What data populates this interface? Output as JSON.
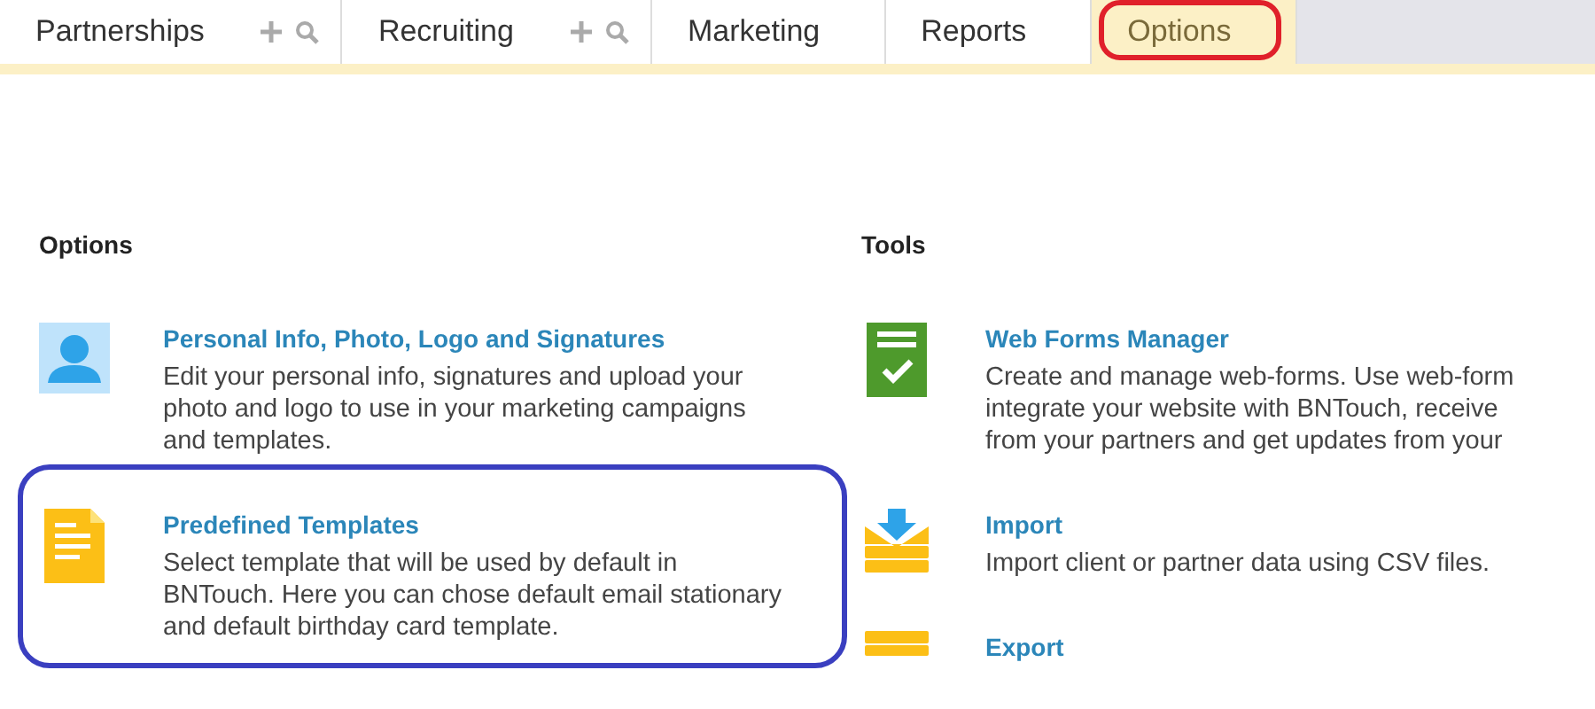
{
  "tabs": [
    {
      "label": "Partnerships",
      "selected": false,
      "actions": true,
      "circled": false
    },
    {
      "label": "Recruiting",
      "selected": false,
      "actions": true,
      "circled": false
    },
    {
      "label": "Marketing",
      "selected": false,
      "actions": false,
      "circled": false
    },
    {
      "label": "Reports",
      "selected": false,
      "actions": false,
      "circled": false
    },
    {
      "label": "Options",
      "selected": true,
      "actions": false,
      "circled": true
    }
  ],
  "columns": [
    {
      "heading": "Options",
      "items": [
        {
          "kind": "person",
          "title": "Personal Info, Photo, Logo and Signatures",
          "lines": [
            "Edit your personal info, signatures and upload your",
            "photo and logo to use in your marketing campaigns",
            "and templates."
          ],
          "outlined": false
        },
        {
          "kind": "document",
          "title": "Predefined Templates",
          "lines": [
            "Select template that will be used by default in",
            "BNTouch. Here you can chose default email stationary",
            "and default birthday card template."
          ],
          "outlined": true
        }
      ]
    },
    {
      "heading": "Tools",
      "items": [
        {
          "kind": "form",
          "title": "Web Forms Manager",
          "lines": [
            "Create and manage web-forms. Use web-form",
            "integrate your website with BNTouch, receive",
            "from your partners and get updates from your"
          ],
          "outlined": false
        },
        {
          "kind": "import",
          "title": "Import",
          "lines": [
            "Import client or partner data using CSV files."
          ],
          "outlined": false
        },
        {
          "kind": "export",
          "title": "Export",
          "outlined": false
        }
      ]
    }
  ]
}
